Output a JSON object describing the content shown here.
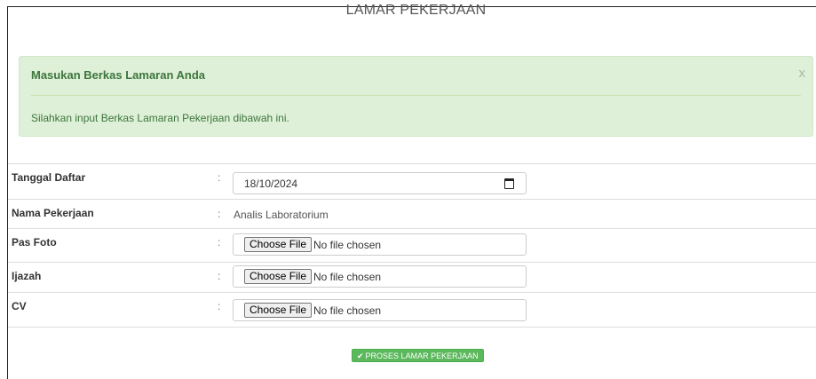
{
  "page": {
    "title": "LAMAR PEKERJAAN"
  },
  "alert": {
    "title": "Masukan Berkas Lamaran Anda",
    "message": "Silahkan input Berkas Lamaran Pekerjaan dibawah ini.",
    "close_symbol": "x",
    "colors": {
      "background": "#dff0d8",
      "text": "#3c763d"
    }
  },
  "form": {
    "separator": ":",
    "fields": [
      {
        "label": "Tanggal Daftar",
        "type": "date",
        "value": "18/10/2024",
        "icon": "calendar-icon"
      },
      {
        "label": "Nama Pekerjaan",
        "type": "text",
        "value": "Analis Laboratorium"
      },
      {
        "label": "Pas Foto",
        "type": "file",
        "button_label": "Choose File",
        "status": "No file chosen"
      },
      {
        "label": "Ijazah",
        "type": "file",
        "button_label": "Choose File",
        "status": "No file chosen"
      },
      {
        "label": "CV",
        "type": "file",
        "button_label": "Choose File",
        "status": "No file chosen"
      }
    ]
  },
  "submit": {
    "label": "PROSES LAMAR PEKERJAAN",
    "icon": "check-icon",
    "color": "#5cb85c"
  }
}
